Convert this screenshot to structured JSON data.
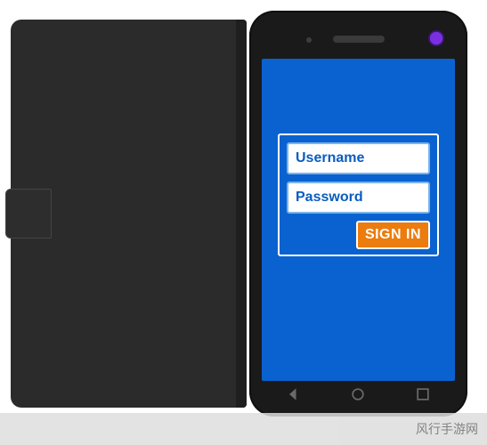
{
  "login": {
    "username_placeholder": "Username",
    "password_placeholder": "Password",
    "signin_label": "SIGN IN"
  },
  "watermark": {
    "text": "风行手游网"
  },
  "colors": {
    "screen_bg": "#0a62d0",
    "accent": "#ec7c0e",
    "case": "#2b2b2b"
  }
}
